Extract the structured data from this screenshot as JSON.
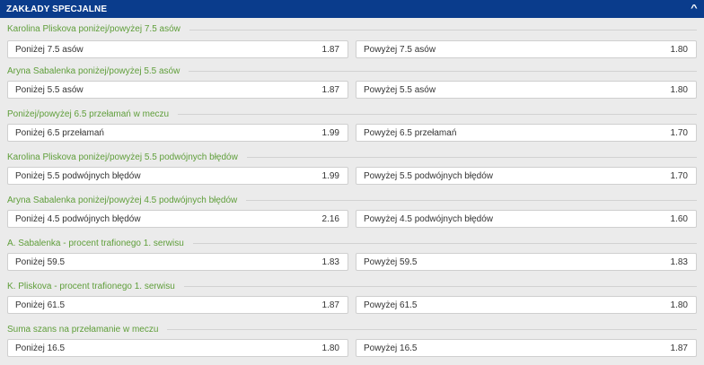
{
  "header": {
    "title": "ZAKŁADY SPECJALNE",
    "collapse_glyph": "^"
  },
  "colors": {
    "header_bg": "#0a3c8c",
    "market_title": "#5f9e3a",
    "background": "#ebebeb"
  },
  "markets": [
    {
      "title": "Karolina Pliskova poniżej/powyżej 7.5 asów",
      "options": [
        {
          "label": "Poniżej 7.5 asów",
          "price": "1.87"
        },
        {
          "label": "Powyżej 7.5 asów",
          "price": "1.80"
        }
      ]
    },
    {
      "title": "Aryna Sabalenka poniżej/powyżej 5.5 asów",
      "options": [
        {
          "label": "Poniżej 5.5 asów",
          "price": "1.87"
        },
        {
          "label": "Powyżej 5.5 asów",
          "price": "1.80"
        }
      ]
    },
    {
      "title": "Poniżej/powyżej 6.5 przełamań w meczu",
      "options": [
        {
          "label": "Poniżej 6.5 przełamań",
          "price": "1.99"
        },
        {
          "label": "Powyżej 6.5 przełamań",
          "price": "1.70"
        }
      ]
    },
    {
      "title": "Karolina Pliskova poniżej/powyżej 5.5 podwójnych błędów",
      "options": [
        {
          "label": "Poniżej 5.5 podwójnych błędów",
          "price": "1.99"
        },
        {
          "label": "Powyżej 5.5 podwójnych błędów",
          "price": "1.70"
        }
      ]
    },
    {
      "title": "Aryna Sabalenka poniżej/powyżej 4.5 podwójnych błędów",
      "options": [
        {
          "label": "Poniżej 4.5 podwójnych błędów",
          "price": "2.16"
        },
        {
          "label": "Powyżej 4.5 podwójnych błędów",
          "price": "1.60"
        }
      ]
    },
    {
      "title": "A. Sabalenka - procent trafionego 1. serwisu",
      "options": [
        {
          "label": "Poniżej 59.5",
          "price": "1.83"
        },
        {
          "label": "Powyżej 59.5",
          "price": "1.83"
        }
      ]
    },
    {
      "title": "K. Pliskova - procent trafionego 1. serwisu",
      "options": [
        {
          "label": "Poniżej 61.5",
          "price": "1.87"
        },
        {
          "label": "Powyżej 61.5",
          "price": "1.80"
        }
      ]
    },
    {
      "title": "Suma szans na przełamanie w meczu",
      "options": [
        {
          "label": "Poniżej 16.5",
          "price": "1.80"
        },
        {
          "label": "Powyżej 16.5",
          "price": "1.87"
        }
      ]
    }
  ]
}
